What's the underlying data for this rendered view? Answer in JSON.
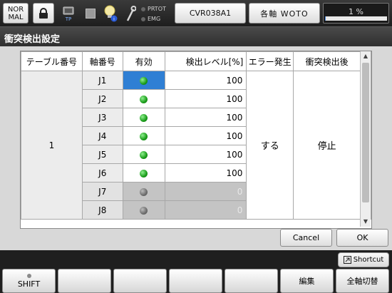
{
  "topbar": {
    "mode_line1": "NOR",
    "mode_line2": "MAL",
    "tp_label": "TP",
    "lamp1": "PRTOT",
    "lamp2": "EMG",
    "controller_button": "CVR038A1",
    "axis_button": "各軸 WOTO",
    "progress_text": "1 %",
    "progress_percent": 1,
    "progress_color": "#3b7ad6"
  },
  "title": "衝突検出設定",
  "table": {
    "headers": [
      "テーブル番号",
      "軸番号",
      "有効",
      "検出レベル[%]",
      "エラー発生",
      "衝突検出後"
    ],
    "table_number": "1",
    "error_occurrence": "する",
    "after_detection": "停止",
    "rows": [
      {
        "axis": "J1",
        "enabled": true,
        "level": "100",
        "selected": true
      },
      {
        "axis": "J2",
        "enabled": true,
        "level": "100"
      },
      {
        "axis": "J3",
        "enabled": true,
        "level": "100"
      },
      {
        "axis": "J4",
        "enabled": true,
        "level": "100"
      },
      {
        "axis": "J5",
        "enabled": true,
        "level": "100"
      },
      {
        "axis": "J6",
        "enabled": true,
        "level": "100"
      },
      {
        "axis": "J7",
        "enabled": false,
        "level": "0"
      },
      {
        "axis": "J8",
        "enabled": false,
        "level": "0"
      }
    ]
  },
  "buttons": {
    "cancel": "Cancel",
    "ok": "OK",
    "shortcut": "Shortcut"
  },
  "function_keys": [
    "SHIFT",
    "",
    "",
    "",
    "",
    "編集",
    "全軸切替"
  ],
  "colors": {
    "selected_cell": "#2f7fd4",
    "enabled_lamp": "#1a9c1a",
    "disabled_lamp": "#6d6d6d"
  }
}
